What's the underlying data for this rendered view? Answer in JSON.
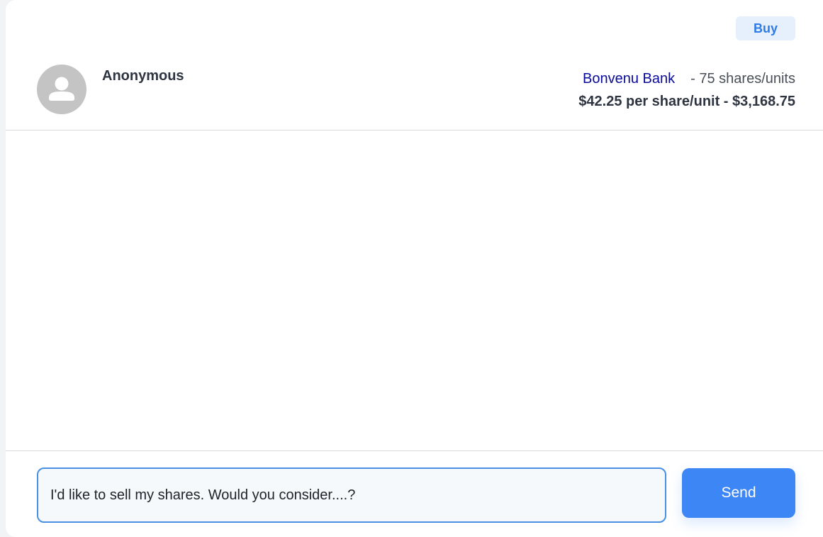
{
  "header": {
    "badge": "Buy",
    "user_name": "Anonymous",
    "avatar_icon": "user-avatar-icon",
    "listing": {
      "company": "Bonvenu Bank",
      "quantity": "- 75 shares/units",
      "price_line": "$42.25 per share/unit - $3,168.75"
    }
  },
  "composer": {
    "input_value": "I'd like to sell my shares. Would you consider....?",
    "send_label": "Send"
  },
  "colors": {
    "accent": "#3d86f5",
    "company_link": "#0a0a9a",
    "badge_bg": "#e6f0fc"
  }
}
